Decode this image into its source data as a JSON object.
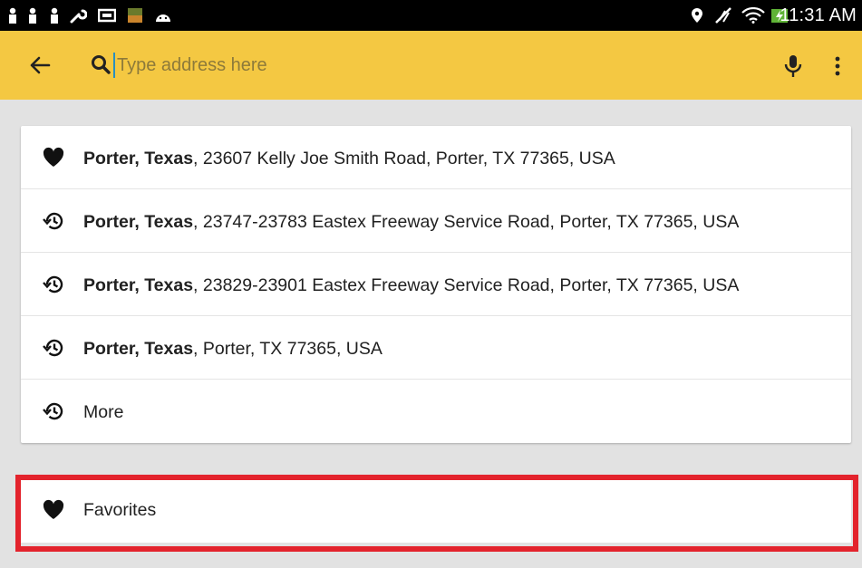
{
  "status_bar": {
    "time": "11:31 AM"
  },
  "app_bar": {
    "search_placeholder": "Type address here"
  },
  "results": [
    {
      "icon": "heart-icon",
      "bold": "Porter, Texas",
      "rest": ", 23607 Kelly Joe Smith Road, Porter, TX 77365, USA"
    },
    {
      "icon": "history-icon",
      "bold": "Porter, Texas",
      "rest": ", 23747-23783 Eastex Freeway Service Road, Porter, TX 77365, USA"
    },
    {
      "icon": "history-icon",
      "bold": "Porter, Texas",
      "rest": ", 23829-23901 Eastex Freeway Service Road, Porter, TX 77365, USA"
    },
    {
      "icon": "history-icon",
      "bold": "Porter, Texas",
      "rest": ", Porter, TX 77365, USA"
    },
    {
      "icon": "history-icon",
      "bold": "",
      "rest": "More"
    }
  ],
  "favorites": {
    "label": "Favorites",
    "icon": "heart-icon"
  },
  "colors": {
    "app_bar": "#f4c842",
    "highlight": "#e3232c",
    "background": "#e2e2e2"
  }
}
